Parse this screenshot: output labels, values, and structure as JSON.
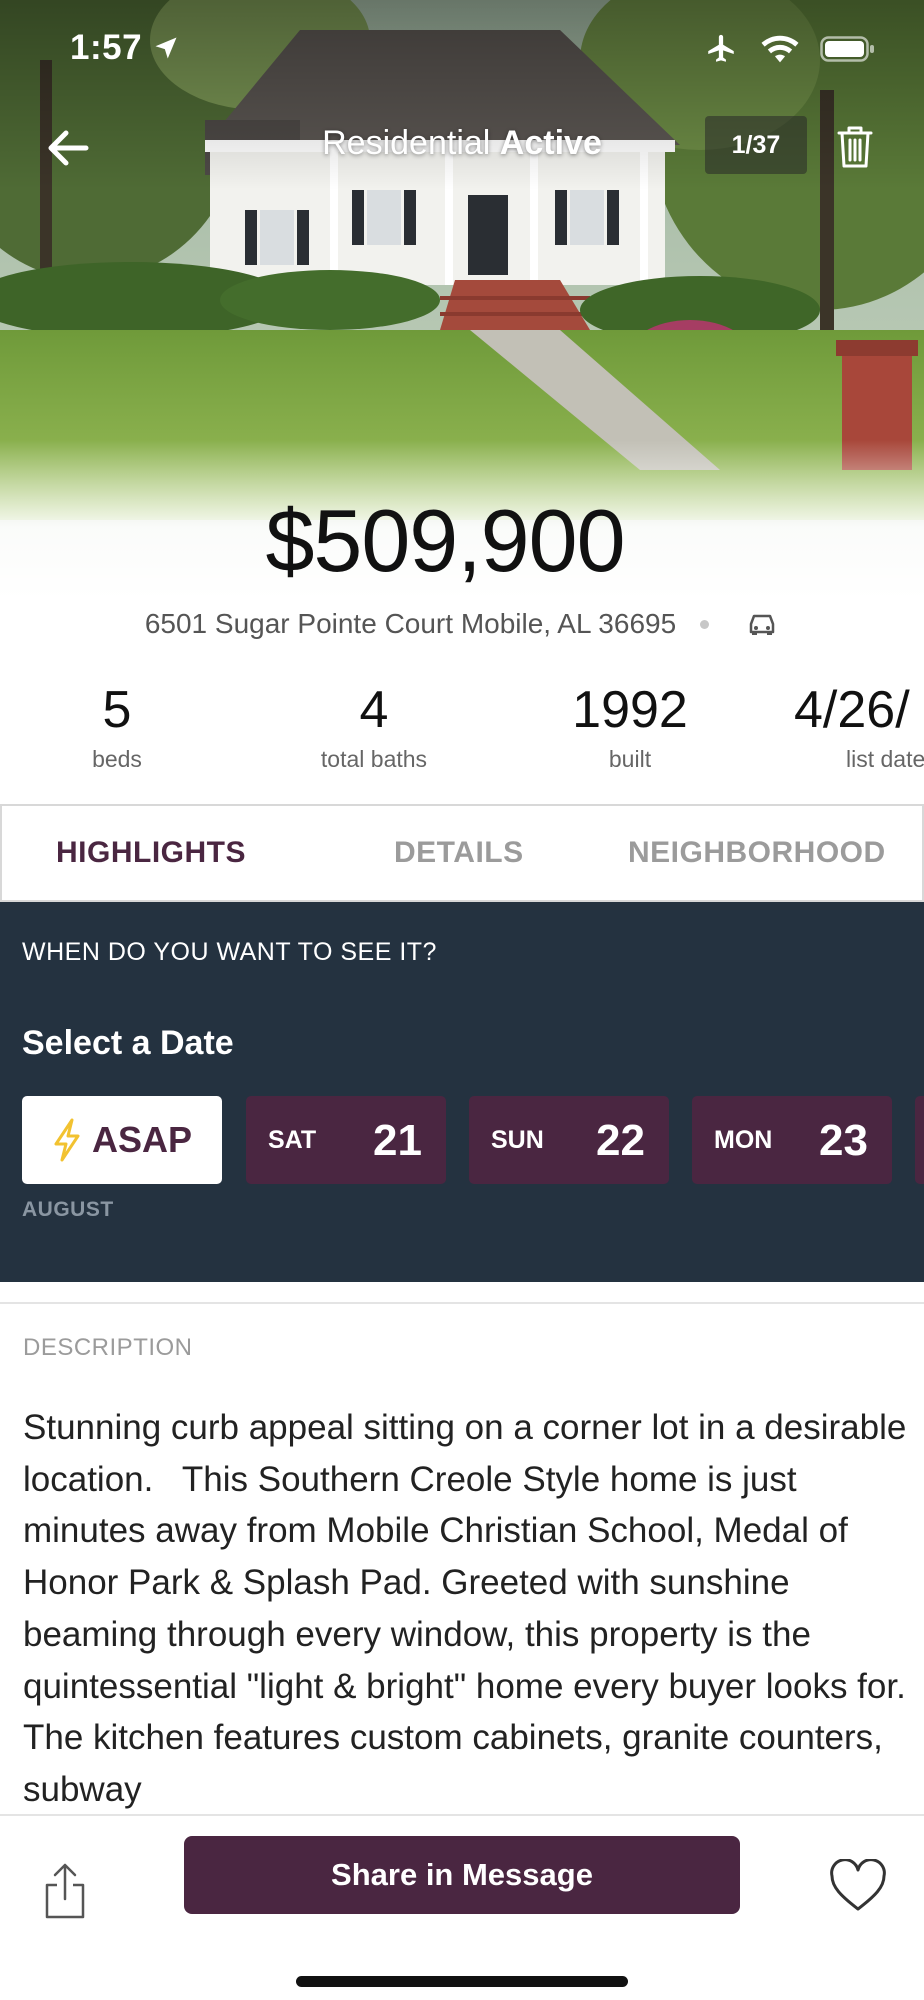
{
  "status_bar": {
    "time": "1:57",
    "icons": [
      "location-arrow-icon",
      "airplane-icon",
      "wifi-icon",
      "battery-icon"
    ]
  },
  "nav": {
    "title_prefix": "Residential",
    "title_status": "Active",
    "photo_counter": "1/37",
    "icons": [
      "back-arrow-icon",
      "trash-icon"
    ]
  },
  "listing": {
    "price": "$509,900",
    "address": "6501 Sugar Pointe Court Mobile, AL 36695",
    "stats": [
      {
        "value": "5",
        "label": "beds"
      },
      {
        "value": "4",
        "label": "total baths"
      },
      {
        "value": "1992",
        "label": "built"
      },
      {
        "value": "4/26/",
        "label": "list date"
      }
    ]
  },
  "tabs": [
    {
      "label": "HIGHLIGHTS",
      "active": true
    },
    {
      "label": "DETAILS",
      "active": false
    },
    {
      "label": "NEIGHBORHOOD",
      "active": false
    }
  ],
  "schedule": {
    "question": "WHEN DO YOU WANT TO SEE IT?",
    "title": "Select a Date",
    "asap_label": "ASAP",
    "days": [
      {
        "dow": "SAT",
        "num": "21"
      },
      {
        "dow": "SUN",
        "num": "22"
      },
      {
        "dow": "MON",
        "num": "23"
      }
    ],
    "month": "AUGUST"
  },
  "description": {
    "label": "DESCRIPTION",
    "text": "Stunning curb appeal sitting on a corner lot in a desirable location.   This Southern Creole Style home is just minutes away from Mobile Christian School, Medal of Honor Park & Splash Pad. Greeted with sunshine beaming through every window, this property is the quintessential \"light & bright\" home every buyer looks for. The kitchen features custom cabinets, granite counters, subway"
  },
  "actions": {
    "message_button": "Share in Message",
    "icons": [
      "share-icon",
      "heart-icon"
    ]
  },
  "colors": {
    "brand_plum": "#4a2641",
    "panel_navy": "#243240",
    "bolt_yellow": "#f2c230"
  }
}
